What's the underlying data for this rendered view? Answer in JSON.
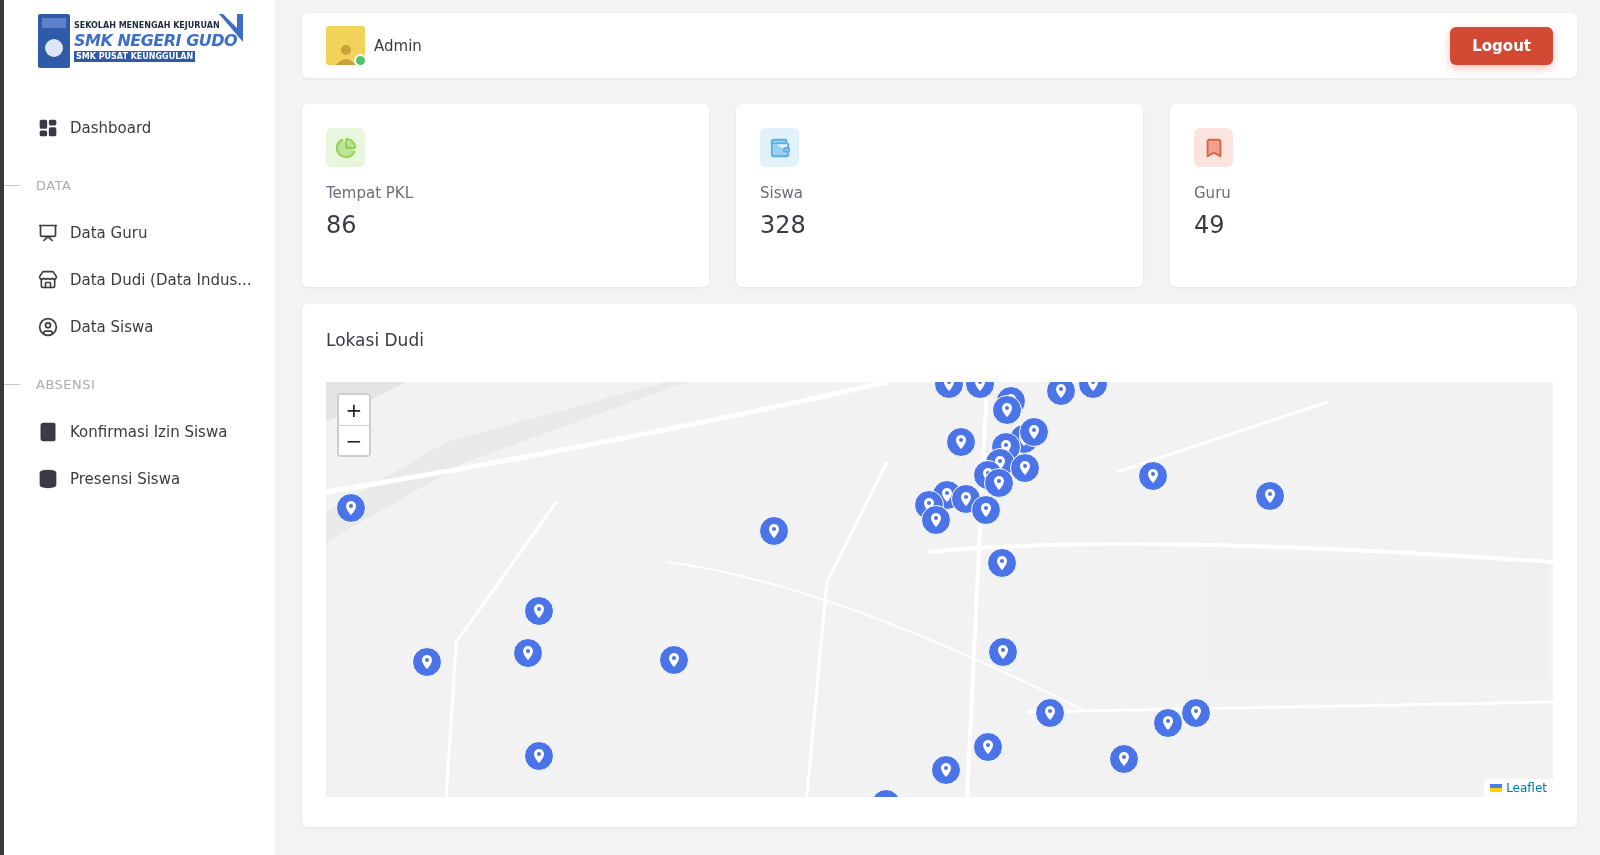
{
  "logo": {
    "line_1": "SEKOLAH MENENGAH KEJURUAN",
    "line_2": "SMK NEGERI GUDO",
    "line_3": "SMK PUSAT KEUNGGULAN"
  },
  "sidebar": {
    "items": [
      {
        "kind": "link",
        "label": "Dashboard"
      },
      {
        "kind": "heading",
        "label": "DATA"
      },
      {
        "kind": "link",
        "label": "Data Guru"
      },
      {
        "kind": "link",
        "label": "Data Dudi (Data Indus..."
      },
      {
        "kind": "link",
        "label": "Data Siswa"
      },
      {
        "kind": "heading",
        "label": "ABSENSI"
      },
      {
        "kind": "link",
        "label": "Konfirmasi Izin Siswa"
      },
      {
        "kind": "link",
        "label": "Presensi Siswa"
      }
    ]
  },
  "header": {
    "user": "Admin",
    "online": true,
    "logout": "Logout"
  },
  "stats": [
    {
      "label": "Tempat PKL",
      "value": "86"
    },
    {
      "label": "Siswa",
      "value": "328"
    },
    {
      "label": "Guru",
      "value": "49"
    }
  ],
  "map_card": {
    "title": "Lokasi Dudi",
    "zoom_in": "+",
    "zoom_out": "−",
    "attribution": "Leaflet"
  }
}
